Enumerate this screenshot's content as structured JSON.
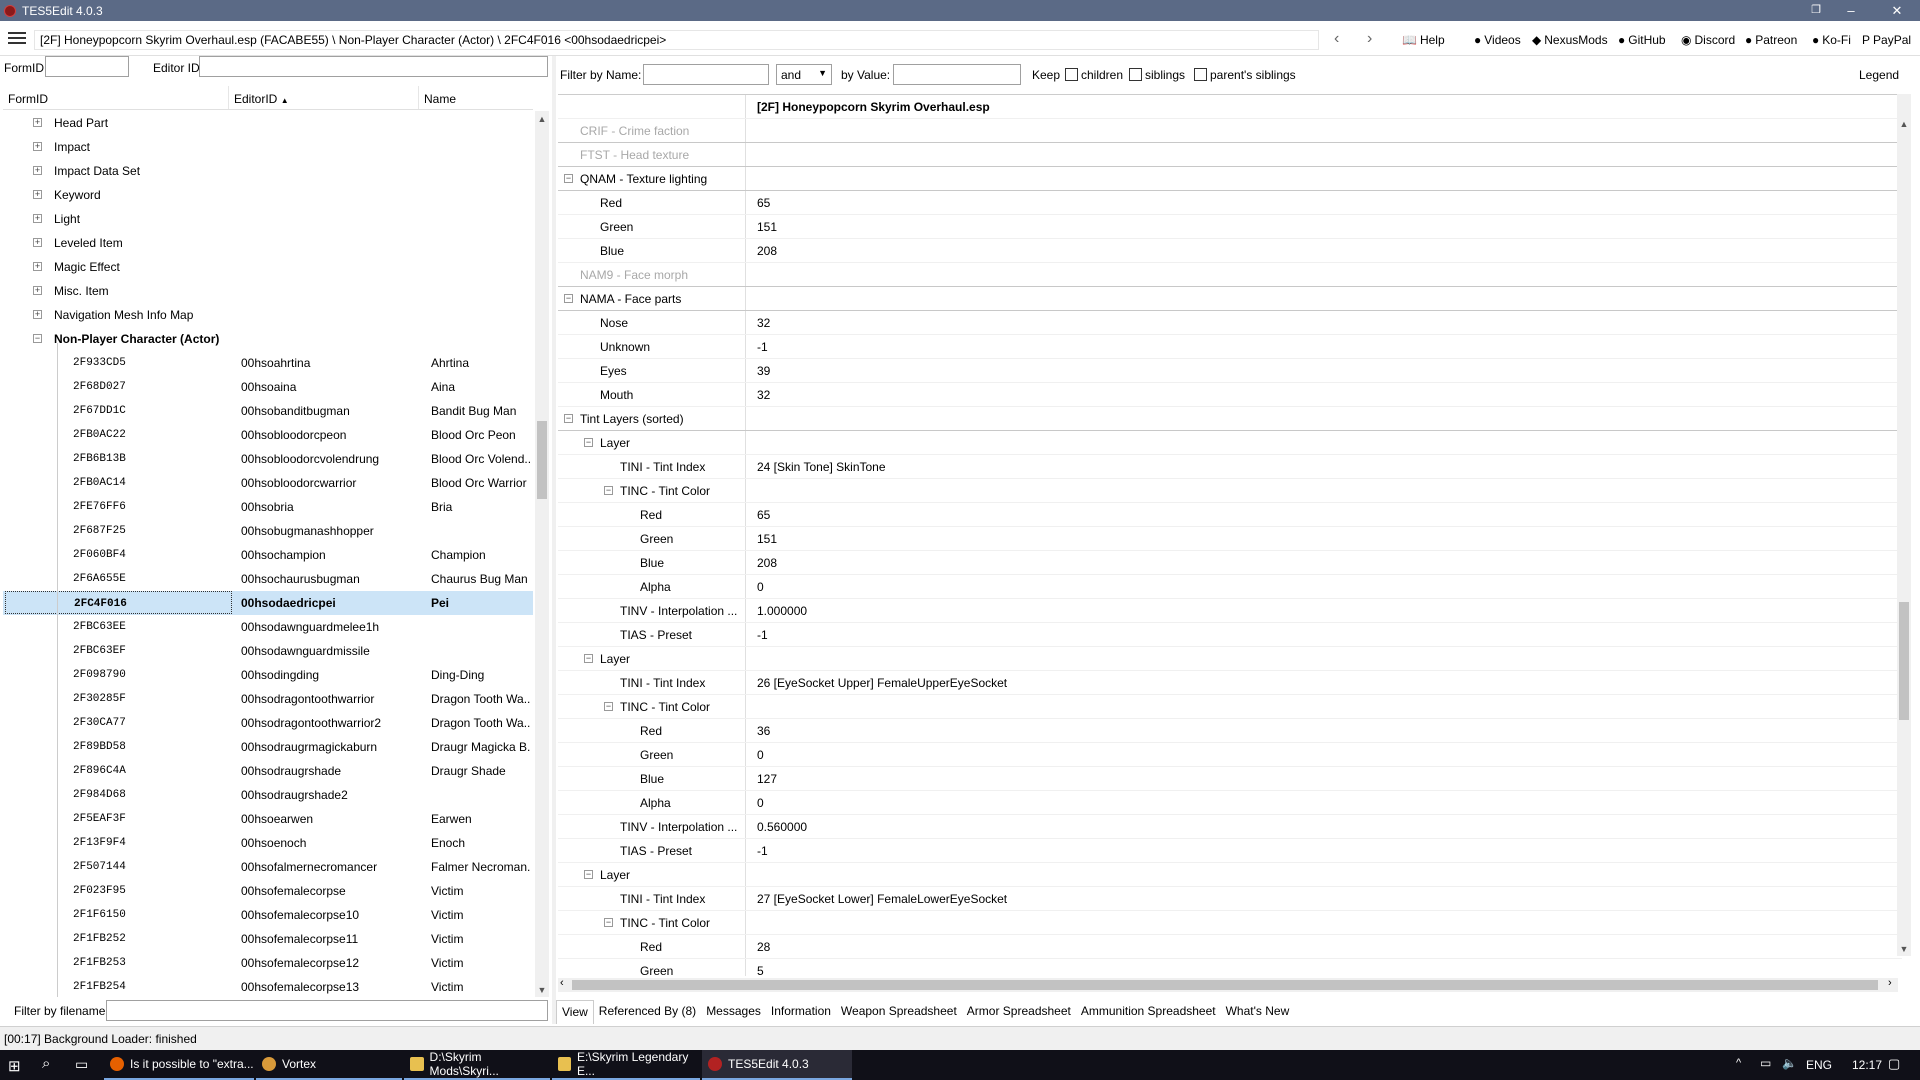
{
  "window": {
    "title": "TES5Edit 4.0.3",
    "controls": [
      "minimize",
      "restore",
      "close"
    ]
  },
  "toolbar": {
    "path": "[2F] Honeypopcorn Skyrim Overhaul.esp (FACABE55) \\ Non-Player Character (Actor) \\ 2FC4F016 <00hsodaedricpei>",
    "links": [
      {
        "label": "Help",
        "icon": "book-icon"
      },
      {
        "label": "Videos",
        "icon": "video-icon"
      },
      {
        "label": "NexusMods",
        "icon": "nexus-icon"
      },
      {
        "label": "GitHub",
        "icon": "github-icon"
      },
      {
        "label": "Discord",
        "icon": "discord-icon"
      },
      {
        "label": "Patreon",
        "icon": "patreon-icon"
      },
      {
        "label": "Ko-Fi",
        "icon": "kofi-icon"
      },
      {
        "label": "PayPal",
        "icon": "paypal-icon"
      }
    ]
  },
  "left_panel": {
    "formid_label": "FormID",
    "editorid_label": "Editor ID",
    "columns": [
      "FormID",
      "EditorID",
      "Name"
    ],
    "categories": [
      {
        "label": "Head Part",
        "expander": "+"
      },
      {
        "label": "Impact",
        "expander": "+"
      },
      {
        "label": "Impact Data Set",
        "expander": "+"
      },
      {
        "label": "Keyword",
        "expander": "+"
      },
      {
        "label": "Light",
        "expander": "+"
      },
      {
        "label": "Leveled Item",
        "expander": "+"
      },
      {
        "label": "Magic Effect",
        "expander": "+"
      },
      {
        "label": "Misc. Item",
        "expander": "+"
      },
      {
        "label": "Navigation Mesh Info Map",
        "expander": "+"
      },
      {
        "label": "Non-Player Character (Actor)",
        "expander": "−"
      }
    ],
    "records": [
      {
        "formid": "2F933CD5",
        "editorid": "00hsoahrtina",
        "name": "Ahrtina"
      },
      {
        "formid": "2F68D027",
        "editorid": "00hsoaina",
        "name": "Aina"
      },
      {
        "formid": "2F67DD1C",
        "editorid": "00hsobanditbugman",
        "name": "Bandit Bug Man"
      },
      {
        "formid": "2FB0AC22",
        "editorid": "00hsobloodorcpeon",
        "name": "Blood Orc Peon"
      },
      {
        "formid": "2FB6B13B",
        "editorid": "00hsobloodorcvolendrung",
        "name": "Blood Orc Volend..."
      },
      {
        "formid": "2FB0AC14",
        "editorid": "00hsobloodorcwarrior",
        "name": "Blood Orc Warrior"
      },
      {
        "formid": "2FE76FF6",
        "editorid": "00hsobria",
        "name": "Bria"
      },
      {
        "formid": "2F687F25",
        "editorid": "00hsobugmanashhopper",
        "name": ""
      },
      {
        "formid": "2F060BF4",
        "editorid": "00hsochampion",
        "name": "Champion"
      },
      {
        "formid": "2F6A655E",
        "editorid": "00hsochaurusbugman",
        "name": "Chaurus Bug Man"
      },
      {
        "formid": "2FC4F016",
        "editorid": "00hsodaedricpei",
        "name": "Pei",
        "selected": true
      },
      {
        "formid": "2FBC63EE",
        "editorid": "00hsodawnguardmelee1h",
        "name": ""
      },
      {
        "formid": "2FBC63EF",
        "editorid": "00hsodawnguardmissile",
        "name": ""
      },
      {
        "formid": "2F098790",
        "editorid": "00hsodingding",
        "name": "Ding-Ding"
      },
      {
        "formid": "2F30285F",
        "editorid": "00hsodragontoothwarrior",
        "name": "Dragon Tooth Wa..."
      },
      {
        "formid": "2F30CA77",
        "editorid": "00hsodragontoothwarrior2",
        "name": "Dragon Tooth Wa..."
      },
      {
        "formid": "2F89BD58",
        "editorid": "00hsodraugrmagickaburn",
        "name": "Draugr Magicka B..."
      },
      {
        "formid": "2F896C4A",
        "editorid": "00hsodraugrshade",
        "name": "Draugr Shade"
      },
      {
        "formid": "2F984D68",
        "editorid": "00hsodraugrshade2",
        "name": ""
      },
      {
        "formid": "2F5EAF3F",
        "editorid": "00hsoearwen",
        "name": "Earwen"
      },
      {
        "formid": "2F13F9F4",
        "editorid": "00hsoenoch",
        "name": "Enoch"
      },
      {
        "formid": "2F507144",
        "editorid": "00hsofalmernecromancer",
        "name": "Falmer Necroman..."
      },
      {
        "formid": "2F023F95",
        "editorid": "00hsofemalecorpse",
        "name": "Victim"
      },
      {
        "formid": "2F1F6150",
        "editorid": "00hsofemalecorpse10",
        "name": "Victim"
      },
      {
        "formid": "2F1FB252",
        "editorid": "00hsofemalecorpse11",
        "name": "Victim"
      },
      {
        "formid": "2F1FB253",
        "editorid": "00hsofemalecorpse12",
        "name": "Victim"
      },
      {
        "formid": "2F1FB254",
        "editorid": "00hsofemalecorpse13",
        "name": "Victim"
      }
    ],
    "filter_filename_label": "Filter by filename:"
  },
  "right_panel": {
    "filter": {
      "by_name_label": "Filter by Name:",
      "operator": "and",
      "by_value_label": "by Value:",
      "keep_label": "Keep",
      "children_label": "children",
      "siblings_label": "siblings",
      "parents_siblings_label": "parent's siblings",
      "legend_label": "Legend"
    },
    "header_file": "[2F] Honeypopcorn Skyrim Overhaul.esp",
    "rows": [
      {
        "key": "CRIF - Crime faction",
        "value": "",
        "level": 0,
        "grey": true
      },
      {
        "key": "FTST - Head texture",
        "value": "",
        "level": 0,
        "grey": true
      },
      {
        "key": "QNAM - Texture lighting",
        "value": "",
        "level": 0,
        "exp": "−"
      },
      {
        "key": "Red",
        "value": "65",
        "level": 1
      },
      {
        "key": "Green",
        "value": "151",
        "level": 1
      },
      {
        "key": "Blue",
        "value": "208",
        "level": 1
      },
      {
        "key": "NAM9 - Face morph",
        "value": "",
        "level": 0,
        "grey": true
      },
      {
        "key": "NAMA - Face parts",
        "value": "",
        "level": 0,
        "exp": "−"
      },
      {
        "key": "Nose",
        "value": "32",
        "level": 1
      },
      {
        "key": "Unknown",
        "value": "-1",
        "level": 1
      },
      {
        "key": "Eyes",
        "value": "39",
        "level": 1
      },
      {
        "key": "Mouth",
        "value": "32",
        "level": 1
      },
      {
        "key": "Tint Layers (sorted)",
        "value": "",
        "level": 0,
        "exp": "−"
      },
      {
        "key": "Layer",
        "value": "",
        "level": 1,
        "exp": "−"
      },
      {
        "key": "TINI - Tint Index",
        "value": "24 [Skin Tone] SkinTone",
        "level": 2
      },
      {
        "key": "TINC - Tint Color",
        "value": "",
        "level": 2,
        "exp": "−"
      },
      {
        "key": "Red",
        "value": "65",
        "level": 3
      },
      {
        "key": "Green",
        "value": "151",
        "level": 3
      },
      {
        "key": "Blue",
        "value": "208",
        "level": 3
      },
      {
        "key": "Alpha",
        "value": "0",
        "level": 3
      },
      {
        "key": "TINV - Interpolation ...",
        "value": "1.000000",
        "level": 2
      },
      {
        "key": "TIAS - Preset",
        "value": "-1",
        "level": 2
      },
      {
        "key": "Layer",
        "value": "",
        "level": 1,
        "exp": "−"
      },
      {
        "key": "TINI - Tint Index",
        "value": "26 [EyeSocket Upper] FemaleUpperEyeSocket",
        "level": 2
      },
      {
        "key": "TINC - Tint Color",
        "value": "",
        "level": 2,
        "exp": "−"
      },
      {
        "key": "Red",
        "value": "36",
        "level": 3
      },
      {
        "key": "Green",
        "value": "0",
        "level": 3
      },
      {
        "key": "Blue",
        "value": "127",
        "level": 3
      },
      {
        "key": "Alpha",
        "value": "0",
        "level": 3
      },
      {
        "key": "TINV - Interpolation ...",
        "value": "0.560000",
        "level": 2
      },
      {
        "key": "TIAS - Preset",
        "value": "-1",
        "level": 2
      },
      {
        "key": "Layer",
        "value": "",
        "level": 1,
        "exp": "−"
      },
      {
        "key": "TINI - Tint Index",
        "value": "27 [EyeSocket Lower] FemaleLowerEyeSocket",
        "level": 2
      },
      {
        "key": "TINC - Tint Color",
        "value": "",
        "level": 2,
        "exp": "−"
      },
      {
        "key": "Red",
        "value": "28",
        "level": 3
      },
      {
        "key": "Green",
        "value": "5",
        "level": 3
      }
    ],
    "tabs": [
      "View",
      "Referenced By (8)",
      "Messages",
      "Information",
      "Weapon Spreadsheet",
      "Armor Spreadsheet",
      "Ammunition Spreadsheet",
      "What's New"
    ]
  },
  "status": {
    "text": "[00:17] Background Loader: finished"
  },
  "taskbar": {
    "items": [
      {
        "label": "Is it possible to \"extra...",
        "icon": "firefox-icon"
      },
      {
        "label": "Vortex",
        "icon": "vortex-icon"
      },
      {
        "label": "D:\\Skyrim Mods\\Skyri...",
        "icon": "folder-icon"
      },
      {
        "label": "E:\\Skyrim Legendary E...",
        "icon": "folder-icon"
      },
      {
        "label": "TES5Edit 4.0.3",
        "icon": "tes5edit-icon"
      }
    ],
    "lang": "ENG",
    "clock": "12:17"
  },
  "colors": {
    "titlebar": "#5b6a86",
    "selection": "#cce4f7",
    "taskbar": "#101018"
  }
}
